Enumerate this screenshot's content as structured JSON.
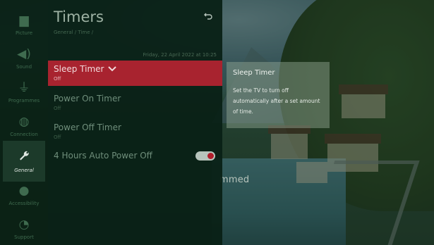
{
  "rail": {
    "items": [
      {
        "label": "Picture",
        "icon": "picture-icon"
      },
      {
        "label": "Sound",
        "icon": "speaker-icon"
      },
      {
        "label": "Programmes",
        "icon": "antenna-icon"
      },
      {
        "label": "Connection",
        "icon": "globe-icon"
      },
      {
        "label": "General",
        "icon": "wrench-icon"
      },
      {
        "label": "Accessibility",
        "icon": "accessibility-icon"
      },
      {
        "label": "Support",
        "icon": "support-icon"
      }
    ]
  },
  "panel": {
    "title": "Timers",
    "breadcrumb": "General / Time /",
    "datetime": "Friday, 22 April 2022 at 10:25"
  },
  "menu": {
    "sleep_timer": {
      "title": "Sleep Timer",
      "value": "Off"
    },
    "power_on_timer": {
      "title": "Power On Timer",
      "value": "Off"
    },
    "power_off_timer": {
      "title": "Power Off Timer",
      "value": "Off"
    },
    "auto_power_off": {
      "title": "4 Hours Auto Power Off",
      "enabled": true
    }
  },
  "info": {
    "title": "Sleep Timer",
    "body": "Set the TV to turn off automatically after a set amount of time."
  },
  "background_text": "mmed",
  "colors": {
    "selected": "#a8232f",
    "panel": "#0a2116",
    "toggle_knob": "#b01f2c"
  }
}
